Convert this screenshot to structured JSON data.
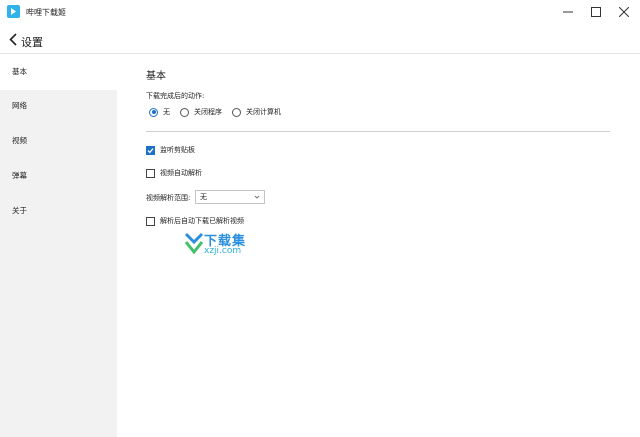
{
  "window": {
    "title": "哔哩下载姬",
    "brand_color": "#2fb3e8"
  },
  "header": {
    "title": "设置"
  },
  "sidebar": {
    "items": [
      {
        "label": "基本",
        "active": true
      },
      {
        "label": "网络",
        "active": false
      },
      {
        "label": "视频",
        "active": false
      },
      {
        "label": "弹幕",
        "active": false
      },
      {
        "label": "关于",
        "active": false
      }
    ]
  },
  "main": {
    "section_title": "基本",
    "after_download": {
      "label": "下载完成后的动作:",
      "options": [
        {
          "label": "无",
          "checked": true
        },
        {
          "label": "关闭程序",
          "checked": false
        },
        {
          "label": "关闭计算机",
          "checked": false
        }
      ]
    },
    "monitor_clipboard": {
      "label": "监听剪贴板",
      "checked": true
    },
    "auto_parse": {
      "label": "视频自动解析",
      "checked": false
    },
    "parse_scope": {
      "label": "视频解析范围:",
      "value": "无"
    },
    "auto_download": {
      "label": "解析后自动下载已解析视频",
      "checked": false
    }
  },
  "watermark": {
    "text": "下载集",
    "sub": "xzji.com"
  },
  "colors": {
    "accent": "#1f70c8",
    "sidebar_bg": "#f2f2f2"
  }
}
